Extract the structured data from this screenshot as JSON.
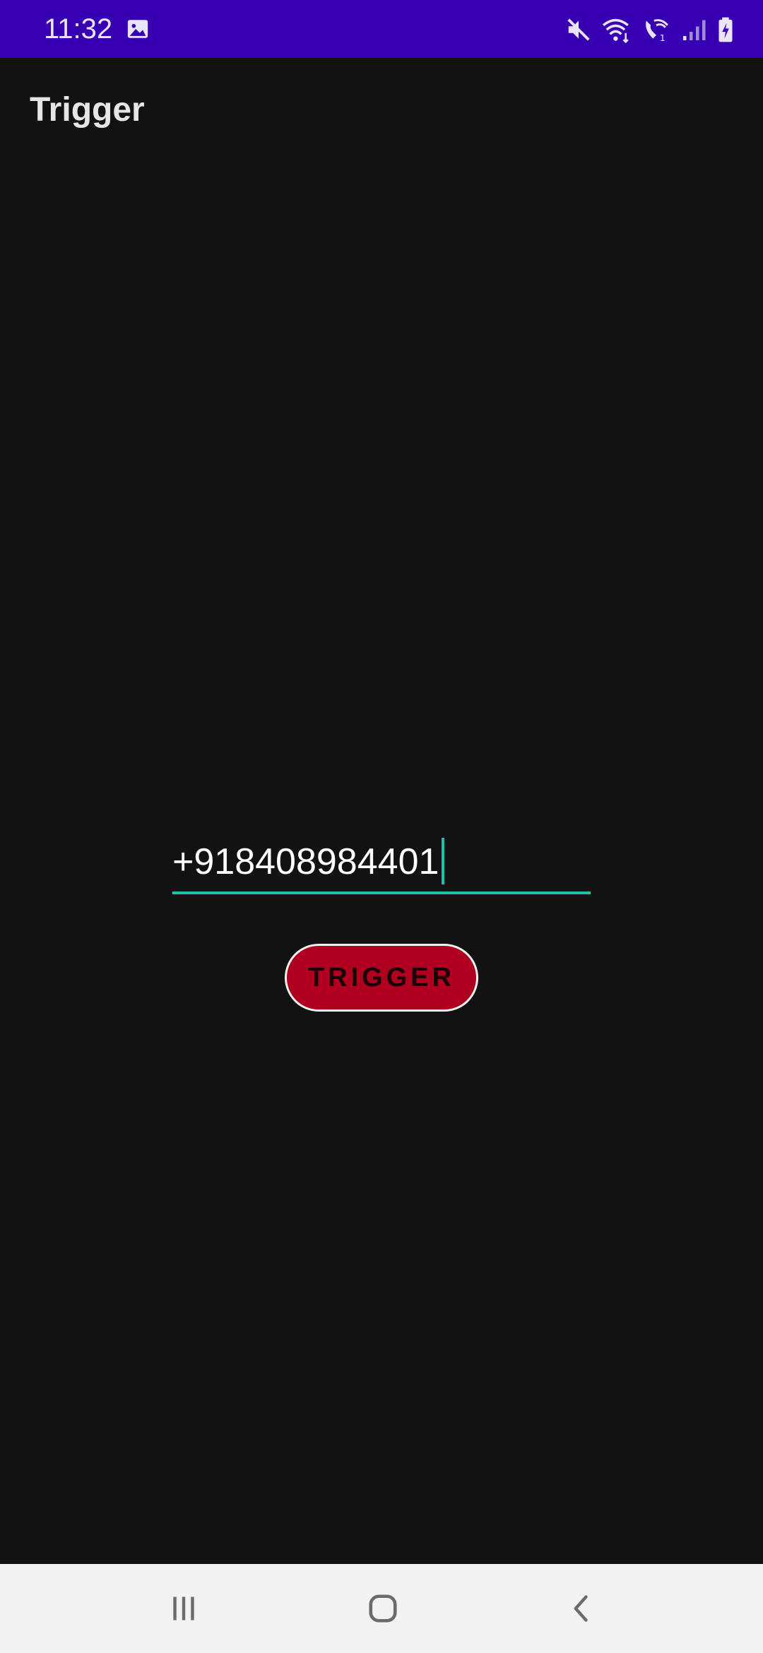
{
  "status_bar": {
    "time": "11:32",
    "background_color": "#3700b3",
    "icons": [
      "gallery-icon",
      "mute-icon",
      "wifi-icon",
      "wifi-calling-icon",
      "signal-icon",
      "battery-charging-icon"
    ]
  },
  "app_bar": {
    "title": "Trigger"
  },
  "form": {
    "phone_value": "+918408984401",
    "accent_color": "#19c2a8",
    "button_label": "TRIGGER",
    "button_color": "#b00020"
  },
  "nav_bar": {
    "icons": [
      "recents-icon",
      "home-icon",
      "back-icon"
    ]
  }
}
